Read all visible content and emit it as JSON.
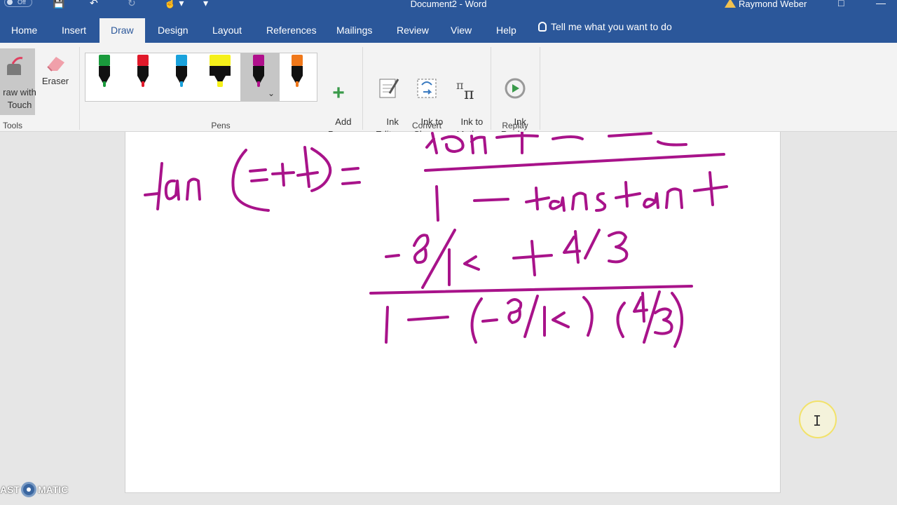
{
  "window": {
    "title": "Document2 - Word",
    "user": "Raymond Weber",
    "autosave_label": "Off"
  },
  "tabs": [
    {
      "label": "Home"
    },
    {
      "label": "Insert"
    },
    {
      "label": "Draw"
    },
    {
      "label": "Design"
    },
    {
      "label": "Layout"
    },
    {
      "label": "References"
    },
    {
      "label": "Mailings"
    },
    {
      "label": "Review"
    },
    {
      "label": "View"
    },
    {
      "label": "Help"
    }
  ],
  "tell_me": "Tell me what you want to do",
  "ribbon": {
    "tools": {
      "group_label": "Tools",
      "draw_with_touch": "raw with\nTouch",
      "eraser": "Eraser"
    },
    "pens": {
      "group_label": "Pens",
      "items": [
        {
          "name": "green-pen",
          "color": "#1a9a3c"
        },
        {
          "name": "red-pen",
          "color": "#e0192a"
        },
        {
          "name": "blue-pen",
          "color": "#1aa2dc"
        },
        {
          "name": "yellow-highlighter",
          "color": "#f5f01a"
        },
        {
          "name": "magenta-pen",
          "color": "#b0108c"
        },
        {
          "name": "orange-pen",
          "color": "#f0781a"
        }
      ],
      "add_pen": "Add\nPen"
    },
    "convert": {
      "group_label": "Convert",
      "ink_editor": "Ink\nEditor",
      "ink_to_shape": "Ink to\nShape",
      "ink_to_math": "Ink to\nMath"
    },
    "replay": {
      "group_label": "Replay",
      "ink_replay": "Ink\nReplay"
    }
  },
  "ink_color": "#a8138a",
  "watermark": {
    "left": "AST",
    "right": "MATIC"
  }
}
